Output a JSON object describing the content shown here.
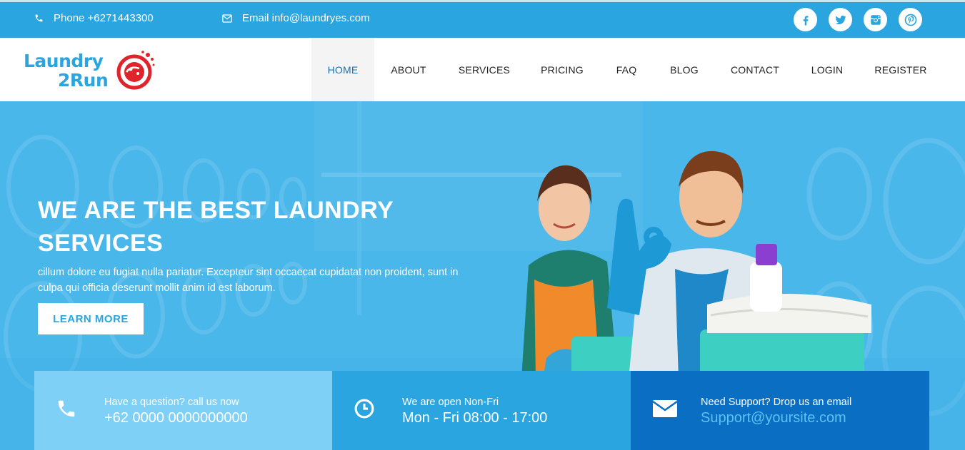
{
  "topbar": {
    "phone": "Phone +6271443300",
    "email": "Email info@laundryes.com",
    "socials": [
      "facebook-icon",
      "twitter-icon",
      "instagram-icon",
      "pinterest-icon"
    ]
  },
  "logo": {
    "line1": "Laundry",
    "line2": "2Run"
  },
  "nav": {
    "items": [
      "HOME",
      "ABOUT",
      "SERVICES",
      "PRICING",
      "FAQ",
      "BLOG",
      "CONTACT",
      "LOGIN",
      "REGISTER"
    ],
    "active": "HOME"
  },
  "hero": {
    "title": "WE ARE THE BEST LAUNDRY SERVICES",
    "text": "cillum dolore eu fugiat nulla pariatur. Excepteur sint occaecat cupidatat non proident, sunt in culpa qui officia deserunt mollit anim id est laborum.",
    "button": "LEARN MORE"
  },
  "info": [
    {
      "icon": "phone-icon",
      "label": "Have a question? call us now",
      "value": "+62 0000 0000000000"
    },
    {
      "icon": "clock-icon",
      "label": "We are open Non-Fri",
      "value": "Mon - Fri 08:00 - 17:00"
    },
    {
      "icon": "envelope-icon",
      "label": "Need Support? Drop us an email",
      "value": "Support@yoursite.com"
    }
  ],
  "colors": {
    "primary": "#2aa5e0",
    "light": "#7fd0f6",
    "dark": "#0a6fc2",
    "accent_red": "#e0242b"
  }
}
